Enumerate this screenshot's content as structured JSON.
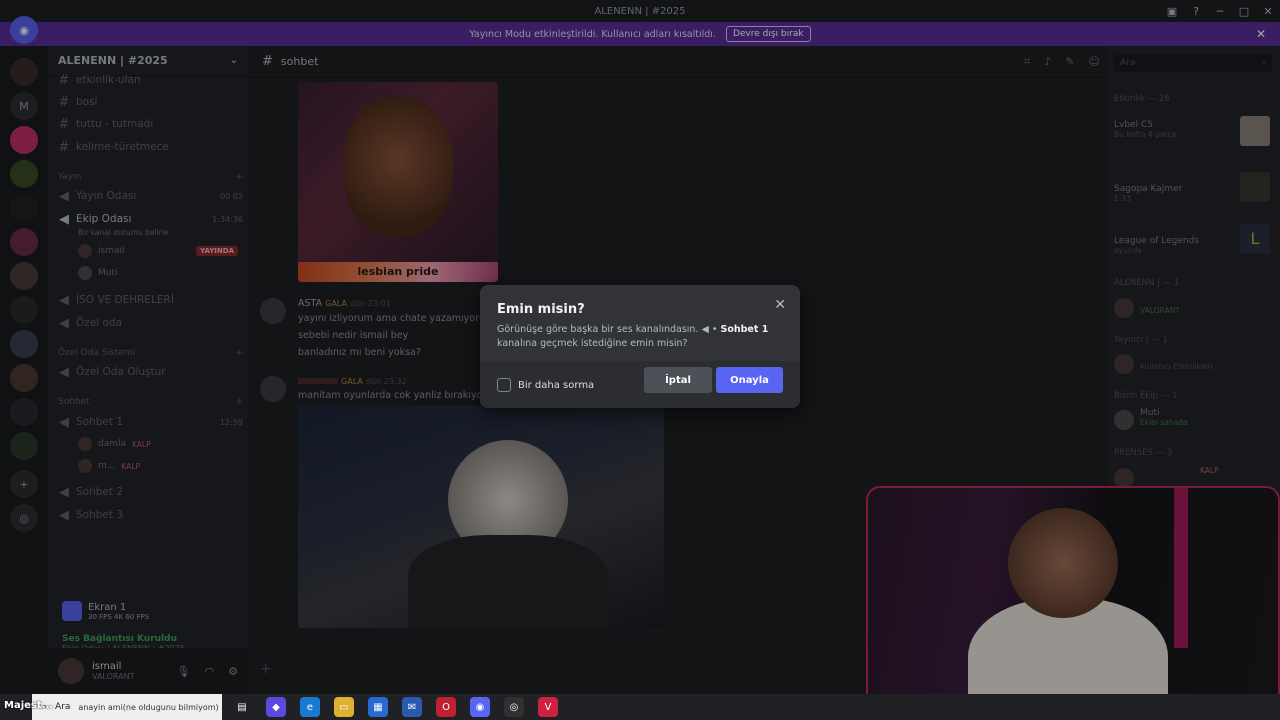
{
  "window": {
    "title": "ALENENN | #2025"
  },
  "notice": {
    "text": "Yayıncı Modu etkinleştirildi. Kullanıcı adları kısaltıldı.",
    "button": "Devre dışı bırak"
  },
  "sidebar": {
    "server_name": "ALENENN | #2025",
    "channels": [
      {
        "name": "etkinlik-ulan"
      },
      {
        "name": "bosi"
      },
      {
        "name": "tuttu - tutmadı"
      },
      {
        "name": "kelime-türetmece"
      }
    ],
    "yayin_category": "Yayın",
    "voice_channels": [
      {
        "name": "Yayın Odası",
        "extra": "00  02"
      },
      {
        "name": "Ekip Odası",
        "extra": "1:34:36",
        "status": "Bir kanal durumu belirle"
      }
    ],
    "ekip_members": [
      {
        "name": "ismail",
        "badge": "YAYINDA"
      },
      {
        "name": "Muti"
      }
    ],
    "other_channels": [
      {
        "name": "İSO VE DEHRELERİ"
      },
      {
        "name": "Özel oda"
      }
    ],
    "ozel_category": "Özel Oda Sistemi",
    "ozel_create": "Özel Oda Oluştur",
    "sohbet_category": "Sohbet",
    "sohbet1": {
      "name": "Sohbet 1",
      "time": "12:59"
    },
    "sohbet1_members": [
      {
        "name": "damla",
        "tag": "KALP"
      },
      {
        "name": "m...",
        "tag": "KALP"
      }
    ],
    "sohbet2": "Sohbet 2",
    "sohbet3": "Sohbet 3",
    "screen": {
      "name": "Ekran 1",
      "sub": "30 FPS 4K 60 FPS"
    },
    "voice": {
      "title": "Ses Bağlantısı Kuruldu",
      "sub": "Ekip Odası / ALENENN | #2025"
    },
    "me": {
      "name": "ismail",
      "status": "VALORANT"
    }
  },
  "channel": {
    "name": "sohbet"
  },
  "messages": [
    {
      "author": "ASTA",
      "tag": "GALA",
      "time": "dün 23:01",
      "lines": [
        "yayını izliyorum ama chate yazamıyorum",
        "sebebi nedir ismail bey",
        "banladınız mı beni yoksa?"
      ]
    },
    {
      "author": "",
      "tag": "GALA",
      "time": "dün 23:32",
      "lines": [
        "manitam oyunlarda cok yanliz bırakıyorsun"
      ]
    }
  ],
  "image1_caption": "lesbian pride",
  "members": {
    "search": "Ara",
    "activity_label": "Etkinlik — 26",
    "activities": [
      {
        "name": "Lvbel C5",
        "sub": "Bu hafta 4 parça"
      },
      {
        "name": "Sagopa Kajmer",
        "sub": "1:33"
      },
      {
        "name": "League of Legends",
        "sub": "oyunda"
      }
    ],
    "group1": "ALENENN | — 1",
    "group1_status": "VALORANT",
    "group2": "Yayıncı | — 1",
    "group2_status": "Kullanıcı Etkinlikleri",
    "group3": "Bizim Ekip — 1",
    "group3_member": "Muti",
    "group3_status": "Ekibi sahada",
    "group4": "PRENSES — 3",
    "group4_tag": "KALP"
  },
  "modal": {
    "title": "Emin misin?",
    "body_pre": "Görünüşe göre başka bir ses kanalındasın.",
    "body_channel": "Sohbet 1",
    "body_post": "kanalına geçmek istediğine emin misin?",
    "checkbox": "Bir daha sorma",
    "cancel": "İptal",
    "confirm": "Onayla"
  },
  "taskbar": {
    "ticker": "Majest...",
    "search": "Ara",
    "song": "anayin ami(ne oldugunu bilmiyom)"
  }
}
